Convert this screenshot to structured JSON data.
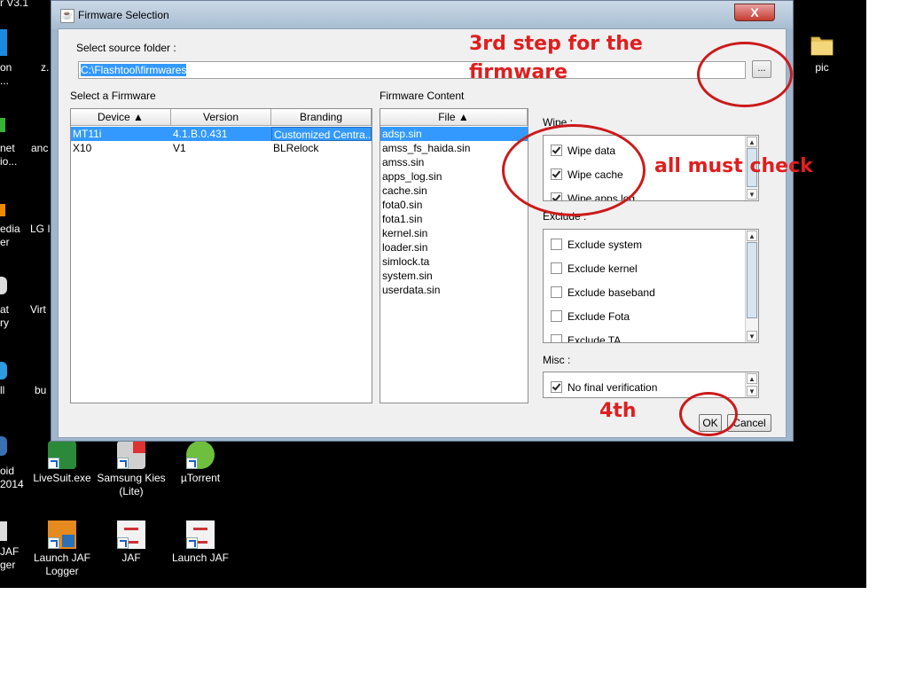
{
  "desktop": {
    "icons": [
      {
        "label": "pic",
        "icon": "folder-icon"
      },
      {
        "label": "LiveSuit.exe",
        "icon": "livesuit-icon"
      },
      {
        "label": "Samsung Kies (Lite)",
        "icon": "samsung-kies-icon"
      },
      {
        "label": "µTorrent",
        "icon": "utorrent-icon"
      },
      {
        "label": "Launch JAF Logger",
        "icon": "jaf-logger-icon"
      },
      {
        "label": "JAF",
        "icon": "jaf-icon"
      },
      {
        "label": "Launch JAF",
        "icon": "launch-jaf-icon"
      }
    ],
    "partial_labels": [
      "r V3.1",
      "on",
      "z.",
      "...",
      "net",
      "io...",
      "anc",
      "edia",
      "er",
      "LG I",
      "at",
      "ry",
      "Virt",
      "ll",
      "bu",
      "oid",
      "2014",
      "JAF",
      "ger"
    ]
  },
  "window": {
    "title": "Firmware Selection",
    "close_label": "X",
    "source_label": "Select source folder :",
    "source_path": "C:\\Flashtool\\firmwares",
    "browse_label": "...",
    "select_firmware_label": "Select a Firmware",
    "firmware_table": {
      "columns": [
        "Device ▲",
        "Version",
        "Branding"
      ],
      "rows": [
        [
          "MT11i",
          "4.1.B.0.431",
          "Customized Centra..."
        ],
        [
          "X10",
          "V1",
          "BLRelock"
        ]
      ]
    },
    "content_label": "Firmware Content",
    "content_header": "File ▲",
    "files": [
      "adsp.sin",
      "amss_fs_haida.sin",
      "amss.sin",
      "apps_log.sin",
      "cache.sin",
      "fota0.sin",
      "fota1.sin",
      "kernel.sin",
      "loader.sin",
      "simlock.ta",
      "system.sin",
      "userdata.sin"
    ],
    "wipe_label": "Wipe :",
    "wipe_items": [
      {
        "label": "Wipe data",
        "checked": true
      },
      {
        "label": "Wipe cache",
        "checked": true
      },
      {
        "label": "Wipe apps log",
        "checked": true
      }
    ],
    "exclude_label": "Exclude :",
    "exclude_items": [
      {
        "label": "Exclude system",
        "checked": false
      },
      {
        "label": "Exclude kernel",
        "checked": false
      },
      {
        "label": "Exclude baseband",
        "checked": false
      },
      {
        "label": "Exclude Fota",
        "checked": false
      },
      {
        "label": "Exclude TA",
        "checked": false
      }
    ],
    "misc_label": "Misc :",
    "misc_items": [
      {
        "label": "No final verification",
        "checked": true
      }
    ],
    "ok_label": "OK",
    "cancel_label": "Cancel"
  },
  "annotations": {
    "step3": "3rd step for the firmware",
    "check_all": "all must check",
    "step4": "4th",
    "color": "#e01e1e"
  }
}
